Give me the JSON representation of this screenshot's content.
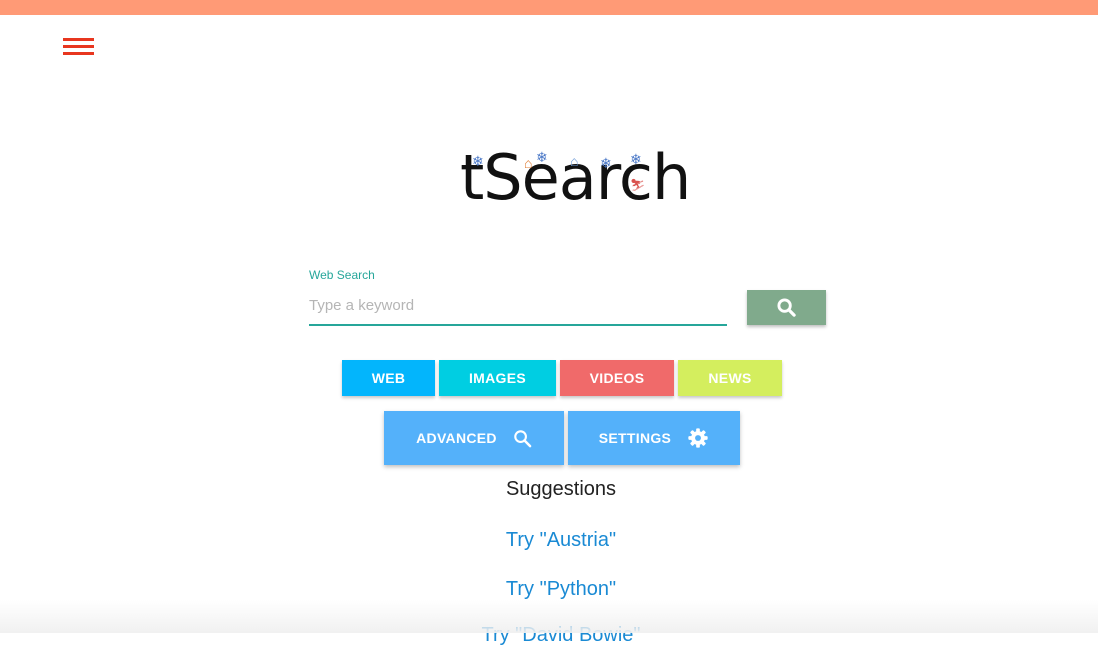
{
  "header": {
    "accent_color": "#ff9a76",
    "menu_icon": "hamburger-menu-icon"
  },
  "logo": {
    "text": "tSearch"
  },
  "search": {
    "label": "Web Search",
    "placeholder": "Type a keyword",
    "value": "",
    "button_icon": "search-icon"
  },
  "categories": [
    {
      "label": "WEB",
      "color": "#03b5fc"
    },
    {
      "label": "IMAGES",
      "color": "#00cee2"
    },
    {
      "label": "VIDEOS",
      "color": "#f06a6a"
    },
    {
      "label": "NEWS",
      "color": "#d4ee5e"
    }
  ],
  "actions": {
    "advanced": {
      "label": "ADVANCED",
      "icon": "search-icon"
    },
    "settings": {
      "label": "SETTINGS",
      "icon": "gear-icon"
    }
  },
  "suggestions": {
    "title": "Suggestions",
    "items": [
      "Try \"Austria\"",
      "Try \"Python\"",
      "Try \"David Bowie\""
    ]
  }
}
